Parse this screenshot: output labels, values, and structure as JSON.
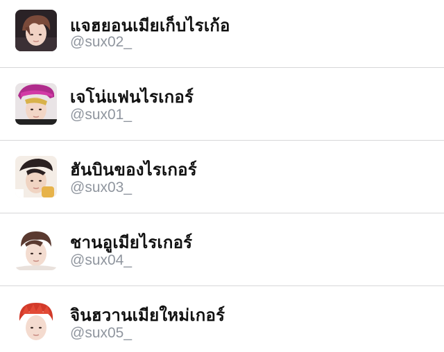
{
  "accounts": [
    {
      "display_name": "แจฮยอนเมียเก็บไรเก้อ",
      "handle": "@sux02_",
      "avatar_icon": "profile-photo"
    },
    {
      "display_name": "เจโน่แฟนไรเกอร์",
      "handle": "@sux01_",
      "avatar_icon": "profile-photo"
    },
    {
      "display_name": "ฮันบินของไรเกอร์",
      "handle": "@sux03_",
      "avatar_icon": "profile-photo"
    },
    {
      "display_name": "ชานอูเมียไรเกอร์",
      "handle": "@sux04_",
      "avatar_icon": "profile-photo"
    },
    {
      "display_name": "จินฮวานเมียใหม่เกอร์",
      "handle": "@sux05_",
      "avatar_icon": "profile-photo"
    }
  ],
  "colors": {
    "name_text": "#111111",
    "handle_text": "#8f959e",
    "divider": "#d6d6d8"
  }
}
